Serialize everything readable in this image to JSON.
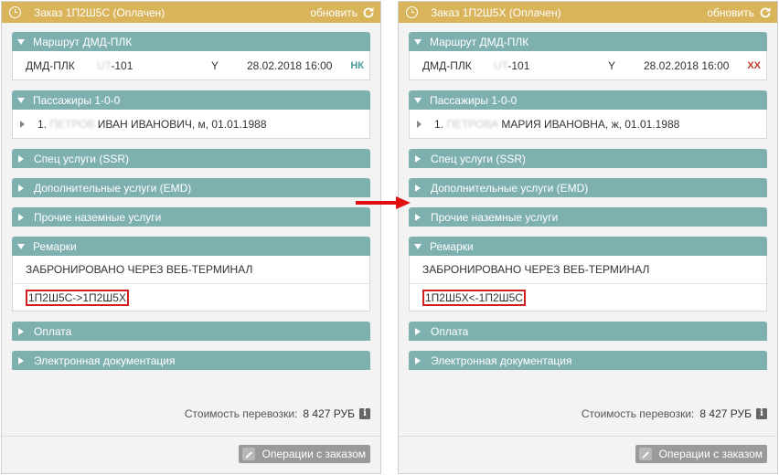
{
  "colors": {
    "header": "#d9b45a",
    "section": "#7fb0b0",
    "highlight": "#d0201f",
    "arrow": "#e01010"
  },
  "panels": [
    {
      "header": {
        "title": "Заказ 1П2Ш5С (Оплачен)",
        "refresh_label": "обновить"
      },
      "route": {
        "title": "Маршрут ДМД-ПЛК",
        "row": {
          "segment": "ДМД-ПЛК",
          "flight_masked": "UT",
          "flight_number": "-101",
          "class": "Y",
          "datetime": "28.02.2018 16:00",
          "status": "НК",
          "status_color": "#4a9a9a"
        }
      },
      "passengers": {
        "title": "Пассажиры 1-0-0",
        "row": {
          "number": "1.",
          "surname_masked": "ПЕТРОВ",
          "details": "ИВАН ИВАНОВИЧ, м, 01.01.1988"
        }
      },
      "ssr_title": "Спец услуги (SSR)",
      "emd_title": "Дополнительные услуги (EMD)",
      "ground_title": "Прочие наземные услуги",
      "remarks": {
        "title": "Ремарки",
        "lines": [
          "ЗАБРОНИРОВАНО ЧЕРЕЗ ВЕБ-ТЕРМИНАЛ",
          "1П2Ш5С->1П2Ш5Х"
        ]
      },
      "payment_title": "Оплата",
      "edocs_title": "Электронная документация",
      "cost": {
        "label": "Стоимость перевозки:",
        "value": "8 427 РУБ",
        "info_glyph": "i"
      },
      "operations_label": "Операции с заказом"
    },
    {
      "header": {
        "title": "Заказ 1П2Ш5Х (Оплачен)",
        "refresh_label": "обновить"
      },
      "route": {
        "title": "Маршрут ДМД-ПЛК",
        "row": {
          "segment": "ДМД-ПЛК",
          "flight_masked": "UT",
          "flight_number": "-101",
          "class": "Y",
          "datetime": "28.02.2018 16:00",
          "status": "XX",
          "status_color": "#c0392b"
        }
      },
      "passengers": {
        "title": "Пассажиры 1-0-0",
        "row": {
          "number": "1.",
          "surname_masked": "ПЕТРОВА",
          "details": "МАРИЯ ИВАНОВНА, ж, 01.01.1988"
        }
      },
      "ssr_title": "Спец услуги (SSR)",
      "emd_title": "Дополнительные услуги (EMD)",
      "ground_title": "Прочие наземные услуги",
      "remarks": {
        "title": "Ремарки",
        "lines": [
          "ЗАБРОНИРОВАНО ЧЕРЕЗ ВЕБ-ТЕРМИНАЛ",
          "1П2Ш5Х<-1П2Ш5С"
        ]
      },
      "payment_title": "Оплата",
      "edocs_title": "Электронная документация",
      "cost": {
        "label": "Стоимость перевозки:",
        "value": "8 427 РУБ",
        "info_glyph": "i"
      },
      "operations_label": "Операции с заказом"
    }
  ]
}
